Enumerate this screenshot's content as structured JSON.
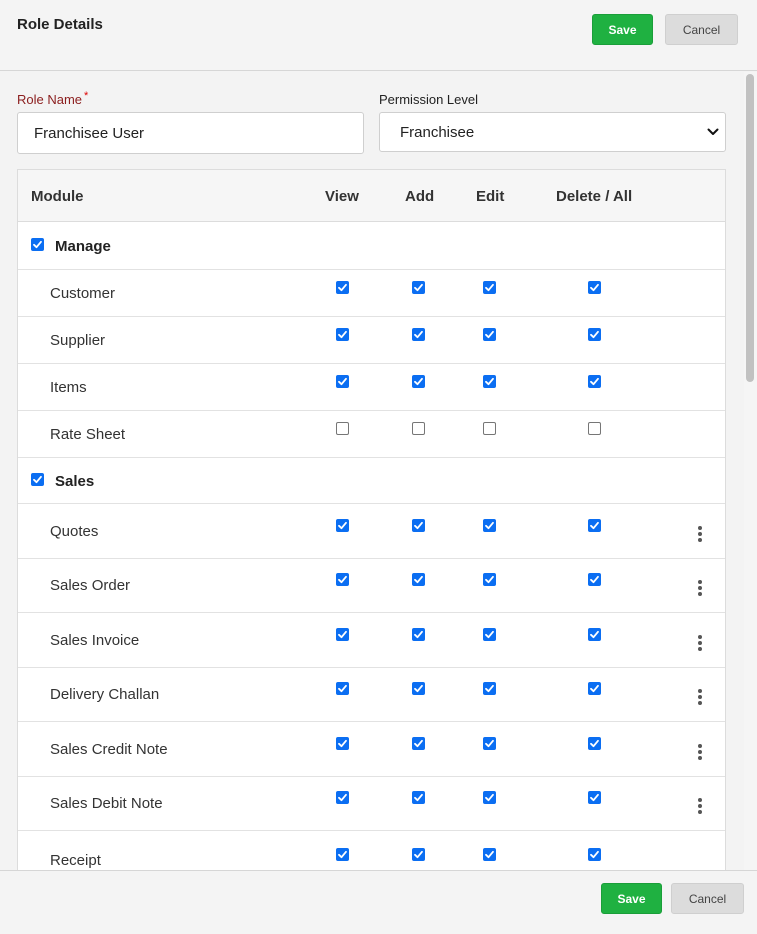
{
  "header": {
    "title": "Role Details",
    "save_label": "Save",
    "cancel_label": "Cancel"
  },
  "form": {
    "role_name_label": "Role Name",
    "required_mark": "*",
    "role_name_value": "Franchisee User",
    "permission_level_label": "Permission Level",
    "permission_level_value": "Franchisee"
  },
  "table": {
    "headers": {
      "module": "Module",
      "view": "View",
      "add": "Add",
      "edit": "Edit",
      "delete_all": "Delete / All"
    },
    "rows": [
      {
        "label": "Manage",
        "group": true,
        "checked": true
      },
      {
        "label": "Customer",
        "view": true,
        "add": true,
        "edit": true,
        "delete_all": true,
        "menu": false
      },
      {
        "label": "Supplier",
        "view": true,
        "add": true,
        "edit": true,
        "delete_all": true,
        "menu": false
      },
      {
        "label": "Items",
        "view": true,
        "add": true,
        "edit": true,
        "delete_all": true,
        "menu": false
      },
      {
        "label": "Rate Sheet",
        "view": false,
        "add": false,
        "edit": false,
        "delete_all": false,
        "menu": false
      },
      {
        "label": "Sales",
        "group": true,
        "checked": true
      },
      {
        "label": "Quotes",
        "view": true,
        "add": true,
        "edit": true,
        "delete_all": true,
        "menu": true
      },
      {
        "label": "Sales Order",
        "view": true,
        "add": true,
        "edit": true,
        "delete_all": true,
        "menu": true
      },
      {
        "label": "Sales Invoice",
        "view": true,
        "add": true,
        "edit": true,
        "delete_all": true,
        "menu": true
      },
      {
        "label": "Delivery Challan",
        "view": true,
        "add": true,
        "edit": true,
        "delete_all": true,
        "menu": true
      },
      {
        "label": "Sales Credit Note",
        "view": true,
        "add": true,
        "edit": true,
        "delete_all": true,
        "menu": true
      },
      {
        "label": "Sales Debit Note",
        "view": true,
        "add": true,
        "edit": true,
        "delete_all": true,
        "menu": true
      },
      {
        "label": "Receipt",
        "view": true,
        "add": true,
        "edit": true,
        "delete_all": true,
        "menu": false
      }
    ]
  },
  "footer": {
    "save_label": "Save",
    "cancel_label": "Cancel"
  },
  "icons": {
    "checkbox": "checkbox-icon",
    "more": "more-vertical-icon",
    "dropdown": "chevron-down-icon"
  },
  "colors": {
    "save": "#1fb141",
    "checkbox": "#0b6ef2",
    "required_label": "#8b1d1d"
  }
}
